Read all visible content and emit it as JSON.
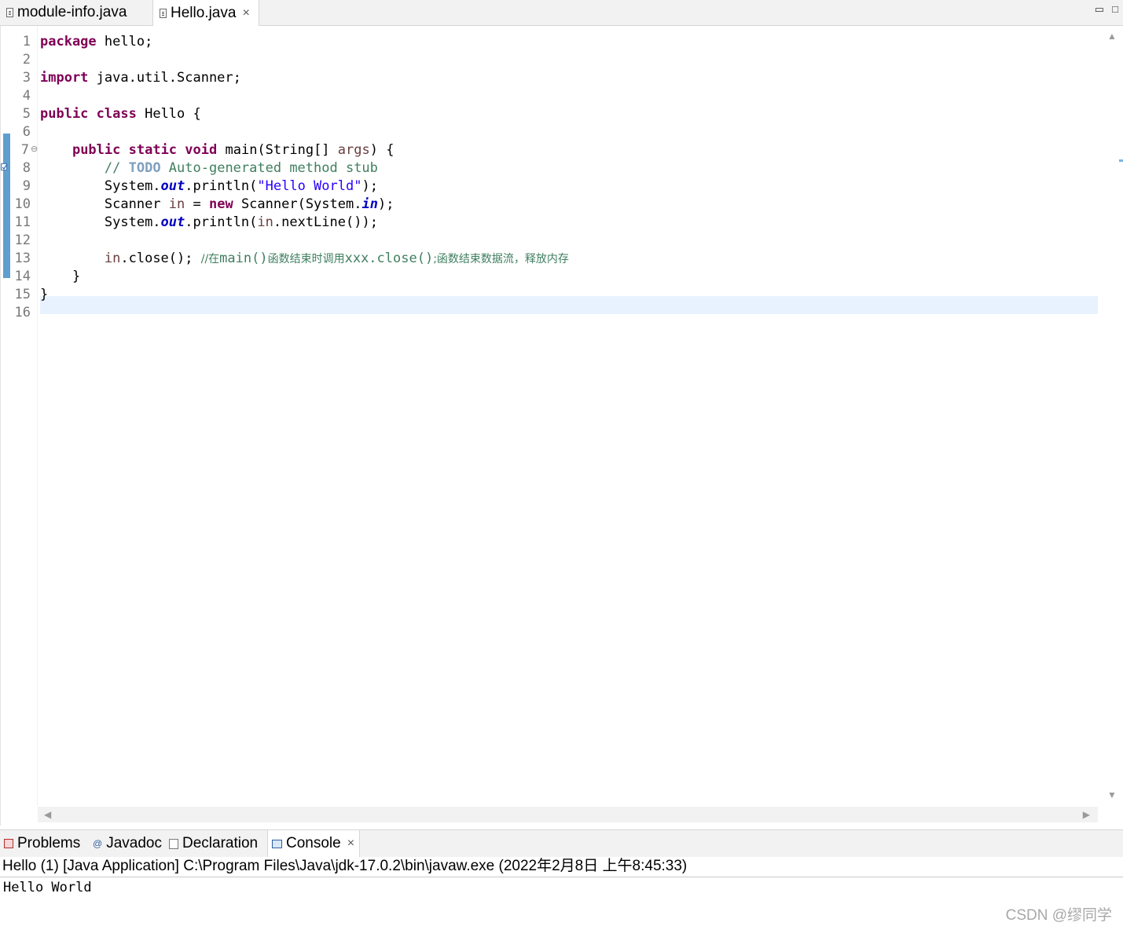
{
  "editor_tabs": [
    {
      "label": "module-info.java",
      "active": false
    },
    {
      "label": "Hello.java",
      "active": true,
      "close": "×"
    }
  ],
  "window_controls": {
    "minimize": "▭",
    "maximize": "□"
  },
  "code": {
    "line_numbers": [
      "1",
      "2",
      "3",
      "4",
      "5",
      "6",
      "7",
      "8",
      "9",
      "10",
      "11",
      "12",
      "13",
      "14",
      "15",
      "16"
    ],
    "line1": {
      "kw": "package",
      "rest": " hello;"
    },
    "line3": {
      "kw": "import",
      "rest": " java.util.Scanner;"
    },
    "line5": {
      "kw1": "public",
      "kw2": "class",
      "rest": " Hello {"
    },
    "line7": {
      "kw1": "public",
      "kw2": "static",
      "kw3": "void",
      "rest1": " main(String[] ",
      "var": "args",
      "rest2": ") {",
      "fold": "⊖"
    },
    "line8": {
      "c1": "// ",
      "todo": "TODO",
      "c2": " Auto-generated method stub"
    },
    "line9": {
      "a": "System.",
      "fld": "out",
      "b": ".println(",
      "str": "\"Hello World\"",
      "c": ");"
    },
    "line10": {
      "a": "Scanner ",
      "var": "in",
      "b": " = ",
      "kw": "new",
      "c": " Scanner(System.",
      "fld": "in",
      "d": ");"
    },
    "line11": {
      "a": "System.",
      "fld": "out",
      "b": ".println(",
      "var": "in",
      "c": ".nextLine());"
    },
    "line13": {
      "var": "in",
      "a": ".close(); ",
      "c1": "//在",
      "c2": "main()",
      "c3": "函数结束时调用",
      "c4": "xxx.close()",
      "c5": ";函数结束数据流，释放内存"
    },
    "line14": {
      "text": "}"
    },
    "line15": {
      "text": "}"
    }
  },
  "bottom_tabs": [
    {
      "label": "Problems"
    },
    {
      "label": "Javadoc"
    },
    {
      "label": "Declaration"
    },
    {
      "label": "Console",
      "active": true,
      "close": "×"
    }
  ],
  "console": {
    "description": "Hello (1) [Java Application] C:\\Program Files\\Java\\jdk-17.0.2\\bin\\javaw.exe  (2022年2月8日 上午8:45:33)",
    "output": "Hello World"
  },
  "watermark": "CSDN @缪同学",
  "colors": {
    "keyword": "#7f0055",
    "string": "#2a00ff",
    "comment": "#3f7f5f",
    "field": "#0000c0",
    "current_line": "#e8f2fe"
  }
}
